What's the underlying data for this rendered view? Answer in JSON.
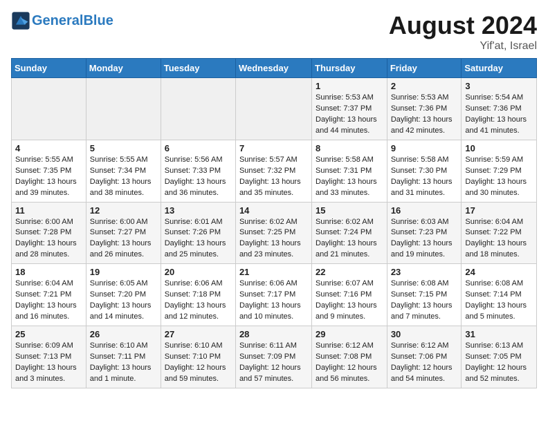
{
  "logo": {
    "text_general": "General",
    "text_blue": "Blue"
  },
  "title": "August 2024",
  "location": "Yif'at, Israel",
  "weekdays": [
    "Sunday",
    "Monday",
    "Tuesday",
    "Wednesday",
    "Thursday",
    "Friday",
    "Saturday"
  ],
  "weeks": [
    [
      {
        "day": "",
        "info": ""
      },
      {
        "day": "",
        "info": ""
      },
      {
        "day": "",
        "info": ""
      },
      {
        "day": "",
        "info": ""
      },
      {
        "day": "1",
        "info": "Sunrise: 5:53 AM\nSunset: 7:37 PM\nDaylight: 13 hours and 44 minutes."
      },
      {
        "day": "2",
        "info": "Sunrise: 5:53 AM\nSunset: 7:36 PM\nDaylight: 13 hours and 42 minutes."
      },
      {
        "day": "3",
        "info": "Sunrise: 5:54 AM\nSunset: 7:36 PM\nDaylight: 13 hours and 41 minutes."
      }
    ],
    [
      {
        "day": "4",
        "info": "Sunrise: 5:55 AM\nSunset: 7:35 PM\nDaylight: 13 hours and 39 minutes."
      },
      {
        "day": "5",
        "info": "Sunrise: 5:55 AM\nSunset: 7:34 PM\nDaylight: 13 hours and 38 minutes."
      },
      {
        "day": "6",
        "info": "Sunrise: 5:56 AM\nSunset: 7:33 PM\nDaylight: 13 hours and 36 minutes."
      },
      {
        "day": "7",
        "info": "Sunrise: 5:57 AM\nSunset: 7:32 PM\nDaylight: 13 hours and 35 minutes."
      },
      {
        "day": "8",
        "info": "Sunrise: 5:58 AM\nSunset: 7:31 PM\nDaylight: 13 hours and 33 minutes."
      },
      {
        "day": "9",
        "info": "Sunrise: 5:58 AM\nSunset: 7:30 PM\nDaylight: 13 hours and 31 minutes."
      },
      {
        "day": "10",
        "info": "Sunrise: 5:59 AM\nSunset: 7:29 PM\nDaylight: 13 hours and 30 minutes."
      }
    ],
    [
      {
        "day": "11",
        "info": "Sunrise: 6:00 AM\nSunset: 7:28 PM\nDaylight: 13 hours and 28 minutes."
      },
      {
        "day": "12",
        "info": "Sunrise: 6:00 AM\nSunset: 7:27 PM\nDaylight: 13 hours and 26 minutes."
      },
      {
        "day": "13",
        "info": "Sunrise: 6:01 AM\nSunset: 7:26 PM\nDaylight: 13 hours and 25 minutes."
      },
      {
        "day": "14",
        "info": "Sunrise: 6:02 AM\nSunset: 7:25 PM\nDaylight: 13 hours and 23 minutes."
      },
      {
        "day": "15",
        "info": "Sunrise: 6:02 AM\nSunset: 7:24 PM\nDaylight: 13 hours and 21 minutes."
      },
      {
        "day": "16",
        "info": "Sunrise: 6:03 AM\nSunset: 7:23 PM\nDaylight: 13 hours and 19 minutes."
      },
      {
        "day": "17",
        "info": "Sunrise: 6:04 AM\nSunset: 7:22 PM\nDaylight: 13 hours and 18 minutes."
      }
    ],
    [
      {
        "day": "18",
        "info": "Sunrise: 6:04 AM\nSunset: 7:21 PM\nDaylight: 13 hours and 16 minutes."
      },
      {
        "day": "19",
        "info": "Sunrise: 6:05 AM\nSunset: 7:20 PM\nDaylight: 13 hours and 14 minutes."
      },
      {
        "day": "20",
        "info": "Sunrise: 6:06 AM\nSunset: 7:18 PM\nDaylight: 13 hours and 12 minutes."
      },
      {
        "day": "21",
        "info": "Sunrise: 6:06 AM\nSunset: 7:17 PM\nDaylight: 13 hours and 10 minutes."
      },
      {
        "day": "22",
        "info": "Sunrise: 6:07 AM\nSunset: 7:16 PM\nDaylight: 13 hours and 9 minutes."
      },
      {
        "day": "23",
        "info": "Sunrise: 6:08 AM\nSunset: 7:15 PM\nDaylight: 13 hours and 7 minutes."
      },
      {
        "day": "24",
        "info": "Sunrise: 6:08 AM\nSunset: 7:14 PM\nDaylight: 13 hours and 5 minutes."
      }
    ],
    [
      {
        "day": "25",
        "info": "Sunrise: 6:09 AM\nSunset: 7:13 PM\nDaylight: 13 hours and 3 minutes."
      },
      {
        "day": "26",
        "info": "Sunrise: 6:10 AM\nSunset: 7:11 PM\nDaylight: 13 hours and 1 minute."
      },
      {
        "day": "27",
        "info": "Sunrise: 6:10 AM\nSunset: 7:10 PM\nDaylight: 12 hours and 59 minutes."
      },
      {
        "day": "28",
        "info": "Sunrise: 6:11 AM\nSunset: 7:09 PM\nDaylight: 12 hours and 57 minutes."
      },
      {
        "day": "29",
        "info": "Sunrise: 6:12 AM\nSunset: 7:08 PM\nDaylight: 12 hours and 56 minutes."
      },
      {
        "day": "30",
        "info": "Sunrise: 6:12 AM\nSunset: 7:06 PM\nDaylight: 12 hours and 54 minutes."
      },
      {
        "day": "31",
        "info": "Sunrise: 6:13 AM\nSunset: 7:05 PM\nDaylight: 12 hours and 52 minutes."
      }
    ]
  ]
}
